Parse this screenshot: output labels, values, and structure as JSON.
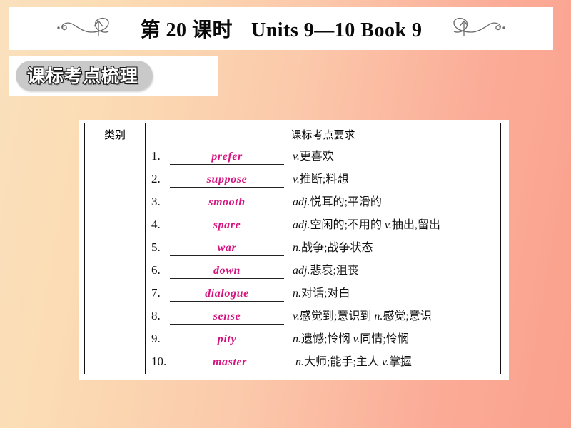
{
  "header": {
    "lesson_label": "第 20 课时",
    "units_label": "Units 9—10 Book 9",
    "left_ornament": "flourish-swirl-left",
    "right_ornament": "flourish-swirl-right"
  },
  "section": {
    "badge_title": "课标考点梳理"
  },
  "table": {
    "headers": {
      "category": "类别",
      "requirement": "课标考点要求"
    },
    "category_value": "",
    "rows": [
      {
        "num": "1.",
        "answer": "prefer",
        "pos1": "v.",
        "meaning1": "更喜欢",
        "pos2": "",
        "meaning2": ""
      },
      {
        "num": "2.",
        "answer": "suppose",
        "pos1": "v.",
        "meaning1": "推断;料想",
        "pos2": "",
        "meaning2": ""
      },
      {
        "num": "3.",
        "answer": "smooth",
        "pos1": "adj.",
        "meaning1": "悦耳的;平滑的",
        "pos2": "",
        "meaning2": ""
      },
      {
        "num": "4.",
        "answer": "spare",
        "pos1": "adj.",
        "meaning1": "空闲的;不用的",
        "pos2": "v.",
        "meaning2": "抽出,留出"
      },
      {
        "num": "5.",
        "answer": "war",
        "pos1": "n.",
        "meaning1": "战争;战争状态",
        "pos2": "",
        "meaning2": ""
      },
      {
        "num": "6.",
        "answer": "down",
        "pos1": "adj.",
        "meaning1": "悲哀;沮丧",
        "pos2": "",
        "meaning2": ""
      },
      {
        "num": "7.",
        "answer": "dialogue",
        "pos1": "n.",
        "meaning1": "对话;对白",
        "pos2": "",
        "meaning2": ""
      },
      {
        "num": "8.",
        "answer": "sense",
        "pos1": "v.",
        "meaning1": "感觉到;意识到",
        "pos2": "n.",
        "meaning2": "感觉;意识"
      },
      {
        "num": "9.",
        "answer": "pity",
        "pos1": "n.",
        "meaning1": "遗憾;怜悯",
        "pos2": "v.",
        "meaning2": "同情;怜悯"
      },
      {
        "num": "10.",
        "answer": "master",
        "pos1": "n.",
        "meaning1": "大师;能手;主人",
        "pos2": "v.",
        "meaning2": "掌握"
      }
    ]
  },
  "colors": {
    "answer_text": "#d4157f",
    "background_start": "#fae0bd",
    "background_end": "#faa18d",
    "badge_fill": "#c9c9c9"
  }
}
